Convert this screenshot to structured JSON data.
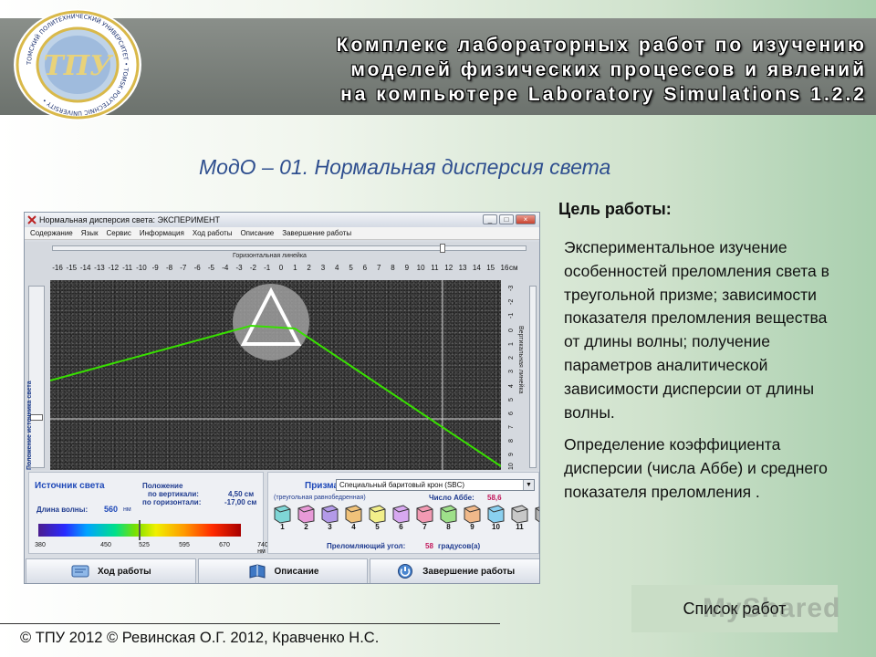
{
  "header": {
    "title_lines": [
      "Комплекс лабораторных работ по изучению",
      "моделей физических процессов и явлений",
      "на компьютере Laboratory Simulations 1.2.2"
    ]
  },
  "section_title": "МодО – 01. Нормальная дисперсия света",
  "app": {
    "window_title": "Нормальная дисперсия света: ЭКСПЕРИМЕНТ",
    "window_buttons": [
      "_",
      "□",
      "×"
    ],
    "menu": [
      "Содержание",
      "Язык",
      "Сервис",
      "Информация",
      "Ход работы",
      "Описание",
      "Завершение работы"
    ],
    "h_ruler_label": "Горизонтальная линейка",
    "h_ruler_ticks": [
      "-16",
      "-15",
      "-14",
      "-13",
      "-12",
      "-11",
      "-10",
      "-9",
      "-8",
      "-7",
      "-6",
      "-5",
      "-4",
      "-3",
      "-2",
      "-1",
      "0",
      "1",
      "2",
      "3",
      "4",
      "5",
      "6",
      "7",
      "8",
      "9",
      "10",
      "11",
      "12",
      "13",
      "14",
      "15",
      "16"
    ],
    "cm_label": "см",
    "v_ruler_label": "Вертикальная линейка",
    "v_ruler_ticks": [
      "-3",
      "-2",
      "-1",
      "0",
      "1",
      "2",
      "3",
      "4",
      "5",
      "6",
      "7",
      "8",
      "9",
      "10"
    ],
    "source_slider_label": "Положение источника света",
    "source": {
      "title": "Источник света",
      "position_title": "Положение",
      "vertical_label": "по вертикали:",
      "vertical_value": "4,50 см",
      "horizontal_label": "по горизонтали:",
      "horizontal_value": "-17,00 см",
      "wavelength_label": "Длина волны:",
      "wavelength_value": "560",
      "wavelength_unit": "нм",
      "wavelength_ticks": [
        "380",
        "450",
        "525",
        "595",
        "670",
        "740 нм"
      ],
      "wavelength_fraction": 0.5
    },
    "prism": {
      "title": "Призма",
      "selected": "Специальный баритовый крон (SBC)",
      "subtitle": "(треугольная равнобедренная)",
      "abbe_label": "Число Аббе:",
      "abbe_value": "58,6",
      "cubes": [
        {
          "num": "1",
          "color": "#7fd6d6"
        },
        {
          "num": "2",
          "color": "#e89ad8"
        },
        {
          "num": "3",
          "color": "#b39ae8"
        },
        {
          "num": "4",
          "color": "#f0c27a"
        },
        {
          "num": "5",
          "color": "#f2ef8a"
        },
        {
          "num": "6",
          "color": "#d7a8f0"
        },
        {
          "num": "7",
          "color": "#f29ab3"
        },
        {
          "num": "8",
          "color": "#9ee08a"
        },
        {
          "num": "9",
          "color": "#f0b98a"
        },
        {
          "num": "10",
          "color": "#8ad0f0"
        },
        {
          "num": "11",
          "color": "#c8c8c8"
        },
        {
          "num": "",
          "color": "#b0b0b0"
        }
      ],
      "angle_label": "Преломляющий угол:",
      "angle_value": "58",
      "angle_unit": "градусов(а)"
    },
    "buttons": [
      "Ход работы",
      "Описание",
      "Завершение работы"
    ],
    "colors": {
      "beam": "#38e000",
      "accent": "#1f49b8",
      "value": "#c2185b"
    }
  },
  "goal": {
    "title": "Цель работы:",
    "paragraphs": [
      "Экспериментальное изучение особенностей преломления света в треугольной призме; зависимости показателя преломления вещества от длины волны; получение параметров аналитической зависимости дисперсии от длины волны.",
      "Определение коэффициента дисперсии (числа Аббе) и среднего показателя преломления ."
    ]
  },
  "list_button": "Список работ",
  "watermark": "MyShared",
  "footer": "© ТПУ 2012 © Ревинская О.Г. 2012, Кравченко Н.С."
}
